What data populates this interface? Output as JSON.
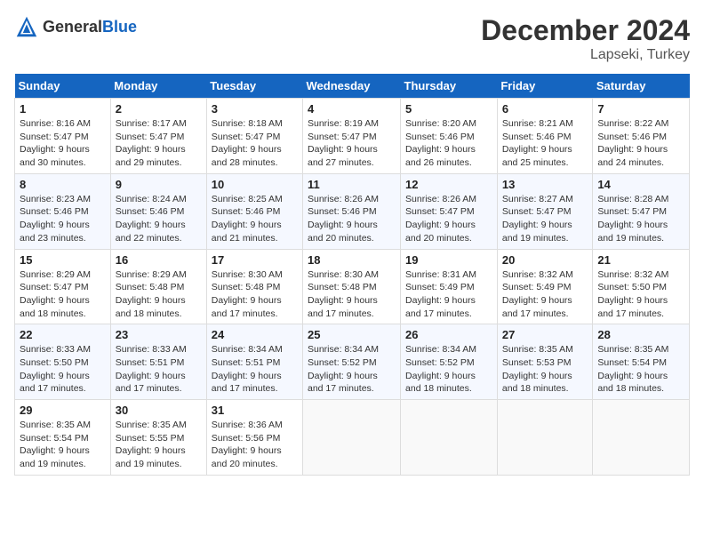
{
  "header": {
    "logo_general": "General",
    "logo_blue": "Blue",
    "month_title": "December 2024",
    "location": "Lapseki, Turkey"
  },
  "weekdays": [
    "Sunday",
    "Monday",
    "Tuesday",
    "Wednesday",
    "Thursday",
    "Friday",
    "Saturday"
  ],
  "weeks": [
    [
      {
        "day": "1",
        "sunrise": "Sunrise: 8:16 AM",
        "sunset": "Sunset: 5:47 PM",
        "daylight": "Daylight: 9 hours and 30 minutes."
      },
      {
        "day": "2",
        "sunrise": "Sunrise: 8:17 AM",
        "sunset": "Sunset: 5:47 PM",
        "daylight": "Daylight: 9 hours and 29 minutes."
      },
      {
        "day": "3",
        "sunrise": "Sunrise: 8:18 AM",
        "sunset": "Sunset: 5:47 PM",
        "daylight": "Daylight: 9 hours and 28 minutes."
      },
      {
        "day": "4",
        "sunrise": "Sunrise: 8:19 AM",
        "sunset": "Sunset: 5:47 PM",
        "daylight": "Daylight: 9 hours and 27 minutes."
      },
      {
        "day": "5",
        "sunrise": "Sunrise: 8:20 AM",
        "sunset": "Sunset: 5:46 PM",
        "daylight": "Daylight: 9 hours and 26 minutes."
      },
      {
        "day": "6",
        "sunrise": "Sunrise: 8:21 AM",
        "sunset": "Sunset: 5:46 PM",
        "daylight": "Daylight: 9 hours and 25 minutes."
      },
      {
        "day": "7",
        "sunrise": "Sunrise: 8:22 AM",
        "sunset": "Sunset: 5:46 PM",
        "daylight": "Daylight: 9 hours and 24 minutes."
      }
    ],
    [
      {
        "day": "8",
        "sunrise": "Sunrise: 8:23 AM",
        "sunset": "Sunset: 5:46 PM",
        "daylight": "Daylight: 9 hours and 23 minutes."
      },
      {
        "day": "9",
        "sunrise": "Sunrise: 8:24 AM",
        "sunset": "Sunset: 5:46 PM",
        "daylight": "Daylight: 9 hours and 22 minutes."
      },
      {
        "day": "10",
        "sunrise": "Sunrise: 8:25 AM",
        "sunset": "Sunset: 5:46 PM",
        "daylight": "Daylight: 9 hours and 21 minutes."
      },
      {
        "day": "11",
        "sunrise": "Sunrise: 8:26 AM",
        "sunset": "Sunset: 5:46 PM",
        "daylight": "Daylight: 9 hours and 20 minutes."
      },
      {
        "day": "12",
        "sunrise": "Sunrise: 8:26 AM",
        "sunset": "Sunset: 5:47 PM",
        "daylight": "Daylight: 9 hours and 20 minutes."
      },
      {
        "day": "13",
        "sunrise": "Sunrise: 8:27 AM",
        "sunset": "Sunset: 5:47 PM",
        "daylight": "Daylight: 9 hours and 19 minutes."
      },
      {
        "day": "14",
        "sunrise": "Sunrise: 8:28 AM",
        "sunset": "Sunset: 5:47 PM",
        "daylight": "Daylight: 9 hours and 19 minutes."
      }
    ],
    [
      {
        "day": "15",
        "sunrise": "Sunrise: 8:29 AM",
        "sunset": "Sunset: 5:47 PM",
        "daylight": "Daylight: 9 hours and 18 minutes."
      },
      {
        "day": "16",
        "sunrise": "Sunrise: 8:29 AM",
        "sunset": "Sunset: 5:48 PM",
        "daylight": "Daylight: 9 hours and 18 minutes."
      },
      {
        "day": "17",
        "sunrise": "Sunrise: 8:30 AM",
        "sunset": "Sunset: 5:48 PM",
        "daylight": "Daylight: 9 hours and 17 minutes."
      },
      {
        "day": "18",
        "sunrise": "Sunrise: 8:30 AM",
        "sunset": "Sunset: 5:48 PM",
        "daylight": "Daylight: 9 hours and 17 minutes."
      },
      {
        "day": "19",
        "sunrise": "Sunrise: 8:31 AM",
        "sunset": "Sunset: 5:49 PM",
        "daylight": "Daylight: 9 hours and 17 minutes."
      },
      {
        "day": "20",
        "sunrise": "Sunrise: 8:32 AM",
        "sunset": "Sunset: 5:49 PM",
        "daylight": "Daylight: 9 hours and 17 minutes."
      },
      {
        "day": "21",
        "sunrise": "Sunrise: 8:32 AM",
        "sunset": "Sunset: 5:50 PM",
        "daylight": "Daylight: 9 hours and 17 minutes."
      }
    ],
    [
      {
        "day": "22",
        "sunrise": "Sunrise: 8:33 AM",
        "sunset": "Sunset: 5:50 PM",
        "daylight": "Daylight: 9 hours and 17 minutes."
      },
      {
        "day": "23",
        "sunrise": "Sunrise: 8:33 AM",
        "sunset": "Sunset: 5:51 PM",
        "daylight": "Daylight: 9 hours and 17 minutes."
      },
      {
        "day": "24",
        "sunrise": "Sunrise: 8:34 AM",
        "sunset": "Sunset: 5:51 PM",
        "daylight": "Daylight: 9 hours and 17 minutes."
      },
      {
        "day": "25",
        "sunrise": "Sunrise: 8:34 AM",
        "sunset": "Sunset: 5:52 PM",
        "daylight": "Daylight: 9 hours and 17 minutes."
      },
      {
        "day": "26",
        "sunrise": "Sunrise: 8:34 AM",
        "sunset": "Sunset: 5:52 PM",
        "daylight": "Daylight: 9 hours and 18 minutes."
      },
      {
        "day": "27",
        "sunrise": "Sunrise: 8:35 AM",
        "sunset": "Sunset: 5:53 PM",
        "daylight": "Daylight: 9 hours and 18 minutes."
      },
      {
        "day": "28",
        "sunrise": "Sunrise: 8:35 AM",
        "sunset": "Sunset: 5:54 PM",
        "daylight": "Daylight: 9 hours and 18 minutes."
      }
    ],
    [
      {
        "day": "29",
        "sunrise": "Sunrise: 8:35 AM",
        "sunset": "Sunset: 5:54 PM",
        "daylight": "Daylight: 9 hours and 19 minutes."
      },
      {
        "day": "30",
        "sunrise": "Sunrise: 8:35 AM",
        "sunset": "Sunset: 5:55 PM",
        "daylight": "Daylight: 9 hours and 19 minutes."
      },
      {
        "day": "31",
        "sunrise": "Sunrise: 8:36 AM",
        "sunset": "Sunset: 5:56 PM",
        "daylight": "Daylight: 9 hours and 20 minutes."
      },
      null,
      null,
      null,
      null
    ]
  ]
}
